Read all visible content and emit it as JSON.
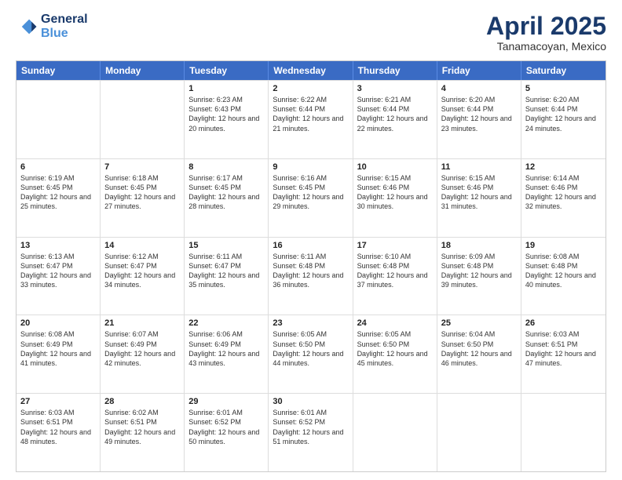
{
  "logo": {
    "line1": "General",
    "line2": "Blue"
  },
  "title": "April 2025",
  "subtitle": "Tanamacoyan, Mexico",
  "days": [
    "Sunday",
    "Monday",
    "Tuesday",
    "Wednesday",
    "Thursday",
    "Friday",
    "Saturday"
  ],
  "rows": [
    [
      {
        "day": "",
        "info": ""
      },
      {
        "day": "",
        "info": ""
      },
      {
        "day": "1",
        "info": "Sunrise: 6:23 AM\nSunset: 6:43 PM\nDaylight: 12 hours and 20 minutes."
      },
      {
        "day": "2",
        "info": "Sunrise: 6:22 AM\nSunset: 6:44 PM\nDaylight: 12 hours and 21 minutes."
      },
      {
        "day": "3",
        "info": "Sunrise: 6:21 AM\nSunset: 6:44 PM\nDaylight: 12 hours and 22 minutes."
      },
      {
        "day": "4",
        "info": "Sunrise: 6:20 AM\nSunset: 6:44 PM\nDaylight: 12 hours and 23 minutes."
      },
      {
        "day": "5",
        "info": "Sunrise: 6:20 AM\nSunset: 6:44 PM\nDaylight: 12 hours and 24 minutes."
      }
    ],
    [
      {
        "day": "6",
        "info": "Sunrise: 6:19 AM\nSunset: 6:45 PM\nDaylight: 12 hours and 25 minutes."
      },
      {
        "day": "7",
        "info": "Sunrise: 6:18 AM\nSunset: 6:45 PM\nDaylight: 12 hours and 27 minutes."
      },
      {
        "day": "8",
        "info": "Sunrise: 6:17 AM\nSunset: 6:45 PM\nDaylight: 12 hours and 28 minutes."
      },
      {
        "day": "9",
        "info": "Sunrise: 6:16 AM\nSunset: 6:45 PM\nDaylight: 12 hours and 29 minutes."
      },
      {
        "day": "10",
        "info": "Sunrise: 6:15 AM\nSunset: 6:46 PM\nDaylight: 12 hours and 30 minutes."
      },
      {
        "day": "11",
        "info": "Sunrise: 6:15 AM\nSunset: 6:46 PM\nDaylight: 12 hours and 31 minutes."
      },
      {
        "day": "12",
        "info": "Sunrise: 6:14 AM\nSunset: 6:46 PM\nDaylight: 12 hours and 32 minutes."
      }
    ],
    [
      {
        "day": "13",
        "info": "Sunrise: 6:13 AM\nSunset: 6:47 PM\nDaylight: 12 hours and 33 minutes."
      },
      {
        "day": "14",
        "info": "Sunrise: 6:12 AM\nSunset: 6:47 PM\nDaylight: 12 hours and 34 minutes."
      },
      {
        "day": "15",
        "info": "Sunrise: 6:11 AM\nSunset: 6:47 PM\nDaylight: 12 hours and 35 minutes."
      },
      {
        "day": "16",
        "info": "Sunrise: 6:11 AM\nSunset: 6:48 PM\nDaylight: 12 hours and 36 minutes."
      },
      {
        "day": "17",
        "info": "Sunrise: 6:10 AM\nSunset: 6:48 PM\nDaylight: 12 hours and 37 minutes."
      },
      {
        "day": "18",
        "info": "Sunrise: 6:09 AM\nSunset: 6:48 PM\nDaylight: 12 hours and 39 minutes."
      },
      {
        "day": "19",
        "info": "Sunrise: 6:08 AM\nSunset: 6:48 PM\nDaylight: 12 hours and 40 minutes."
      }
    ],
    [
      {
        "day": "20",
        "info": "Sunrise: 6:08 AM\nSunset: 6:49 PM\nDaylight: 12 hours and 41 minutes."
      },
      {
        "day": "21",
        "info": "Sunrise: 6:07 AM\nSunset: 6:49 PM\nDaylight: 12 hours and 42 minutes."
      },
      {
        "day": "22",
        "info": "Sunrise: 6:06 AM\nSunset: 6:49 PM\nDaylight: 12 hours and 43 minutes."
      },
      {
        "day": "23",
        "info": "Sunrise: 6:05 AM\nSunset: 6:50 PM\nDaylight: 12 hours and 44 minutes."
      },
      {
        "day": "24",
        "info": "Sunrise: 6:05 AM\nSunset: 6:50 PM\nDaylight: 12 hours and 45 minutes."
      },
      {
        "day": "25",
        "info": "Sunrise: 6:04 AM\nSunset: 6:50 PM\nDaylight: 12 hours and 46 minutes."
      },
      {
        "day": "26",
        "info": "Sunrise: 6:03 AM\nSunset: 6:51 PM\nDaylight: 12 hours and 47 minutes."
      }
    ],
    [
      {
        "day": "27",
        "info": "Sunrise: 6:03 AM\nSunset: 6:51 PM\nDaylight: 12 hours and 48 minutes."
      },
      {
        "day": "28",
        "info": "Sunrise: 6:02 AM\nSunset: 6:51 PM\nDaylight: 12 hours and 49 minutes."
      },
      {
        "day": "29",
        "info": "Sunrise: 6:01 AM\nSunset: 6:52 PM\nDaylight: 12 hours and 50 minutes."
      },
      {
        "day": "30",
        "info": "Sunrise: 6:01 AM\nSunset: 6:52 PM\nDaylight: 12 hours and 51 minutes."
      },
      {
        "day": "",
        "info": ""
      },
      {
        "day": "",
        "info": ""
      },
      {
        "day": "",
        "info": ""
      }
    ]
  ]
}
